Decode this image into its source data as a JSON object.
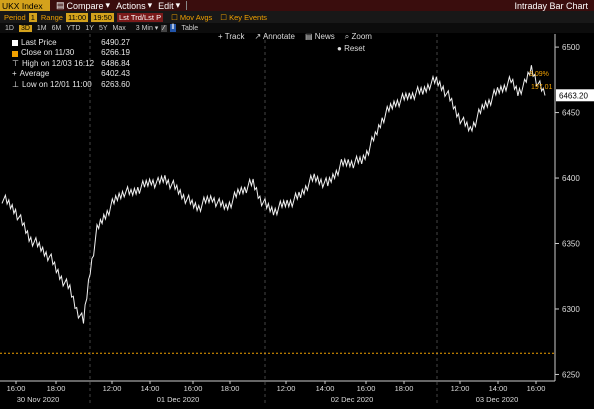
{
  "menubar": {
    "ticker": "UKX Index",
    "compare": "Compare",
    "actions": "Actions",
    "edit": "Edit",
    "chart_title": "Intraday Bar Chart"
  },
  "options": {
    "period_label": "Period",
    "period_value": "1",
    "range_label": "Range",
    "range_start": "11:00",
    "range_end": "19:50",
    "last_trade": "Lst Trd/Lst P",
    "mov_avgs": "Mov Avgs",
    "key_events": "Key Events"
  },
  "ranges": [
    "1D",
    "3D",
    "1M",
    "6M",
    "YTD",
    "1Y",
    "5Y",
    "Max"
  ],
  "selected_range": "3D",
  "interval": "3 Min",
  "table_label": "Table",
  "toolbar": {
    "track": "Track",
    "annotate": "Annotate",
    "news": "News",
    "zoom": "Zoom",
    "reset": "Reset"
  },
  "legend": [
    {
      "label": "Last Price",
      "value": "6490.27",
      "color": "#ffffff"
    },
    {
      "label": "Close on 11/30",
      "value": "6266.19",
      "color": "#f0a000"
    },
    {
      "label": "High on 12/03 16:12",
      "value": "6486.84",
      "color": ""
    },
    {
      "label": "Average",
      "value": "6402.43",
      "color": ""
    },
    {
      "label": "Low on 12/01 11:00",
      "value": "6263.60",
      "color": ""
    }
  ],
  "chart_data": {
    "type": "line",
    "ylim": [
      6245,
      6510
    ],
    "y_ticks": [
      6250,
      6300,
      6350,
      6400,
      6450,
      6500
    ],
    "x_labels": [
      "16:00",
      "18:00",
      "12:00",
      "14:00",
      "16:00",
      "18:00",
      "12:00",
      "14:00",
      "16:00",
      "18:00",
      "12:00",
      "14:00",
      "16:00"
    ],
    "date_labels": [
      "30 Nov 2020",
      "01 Dec 2020",
      "02 Dec 2020",
      "03 Dec 2020"
    ],
    "reference_line": {
      "value": 6266.19,
      "color": "#f0a000"
    },
    "last_value_label": "6463.20",
    "mini_labels": [
      "3.09%",
      "197.01"
    ],
    "series": [
      {
        "values": [
          6385,
          6380,
          6375,
          6365,
          6355,
          6350,
          6345,
          6340,
          6330,
          6322,
          6315,
          6300,
          6290,
          6330,
          6360,
          6370,
          6378,
          6385,
          6390,
          6388,
          6392,
          6394,
          6398,
          6396,
          6400,
          6395,
          6390,
          6385,
          6380,
          6378,
          6382,
          6385,
          6380,
          6378,
          6383,
          6390,
          6393,
          6396,
          6385,
          6378,
          6375,
          6378,
          6381,
          6383,
          6387,
          6395,
          6400,
          6398,
          6395,
          6403,
          6410,
          6412,
          6412,
          6413,
          6422,
          6432,
          6445,
          6452,
          6458,
          6460,
          6463,
          6465,
          6466,
          6472,
          6474,
          6469,
          6460,
          6450,
          6442,
          6437,
          6446,
          6455,
          6460,
          6466,
          6470,
          6474,
          6466,
          6471,
          6484,
          6472,
          6463
        ]
      }
    ]
  }
}
